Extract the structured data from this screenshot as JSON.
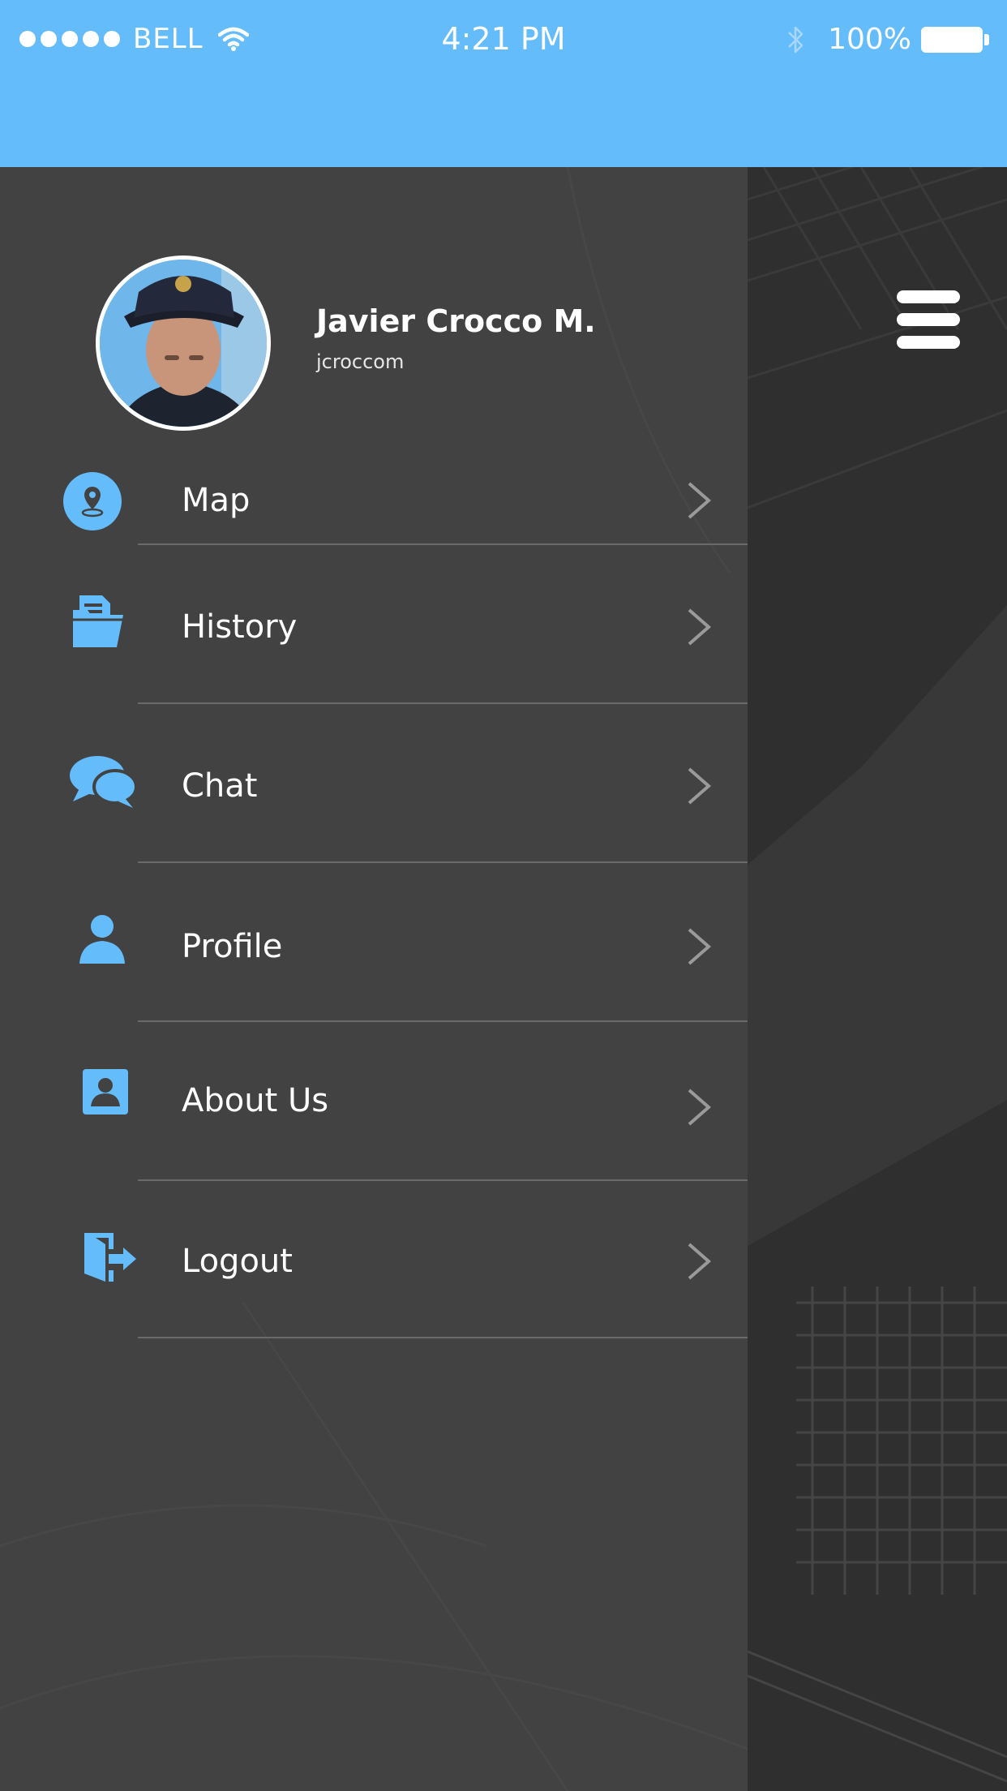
{
  "status_bar": {
    "carrier": "BELL",
    "time": "4:21 PM",
    "battery": "100%"
  },
  "profile": {
    "name": "Javier Crocco M.",
    "username": "jcroccom"
  },
  "menu": {
    "items": [
      {
        "label": "Map",
        "icon": "map-pin-icon"
      },
      {
        "label": "History",
        "icon": "folder-documents-icon"
      },
      {
        "label": "Chat",
        "icon": "chat-bubbles-icon"
      },
      {
        "label": "Profile",
        "icon": "user-icon"
      },
      {
        "label": "About Us",
        "icon": "contact-card-icon"
      },
      {
        "label": "Logout",
        "icon": "logout-door-icon"
      }
    ]
  },
  "colors": {
    "accent": "#64bcfb",
    "drawer_bg": "#424242",
    "map_bg": "#2f2f2f",
    "divider": "#6a6a6a"
  }
}
